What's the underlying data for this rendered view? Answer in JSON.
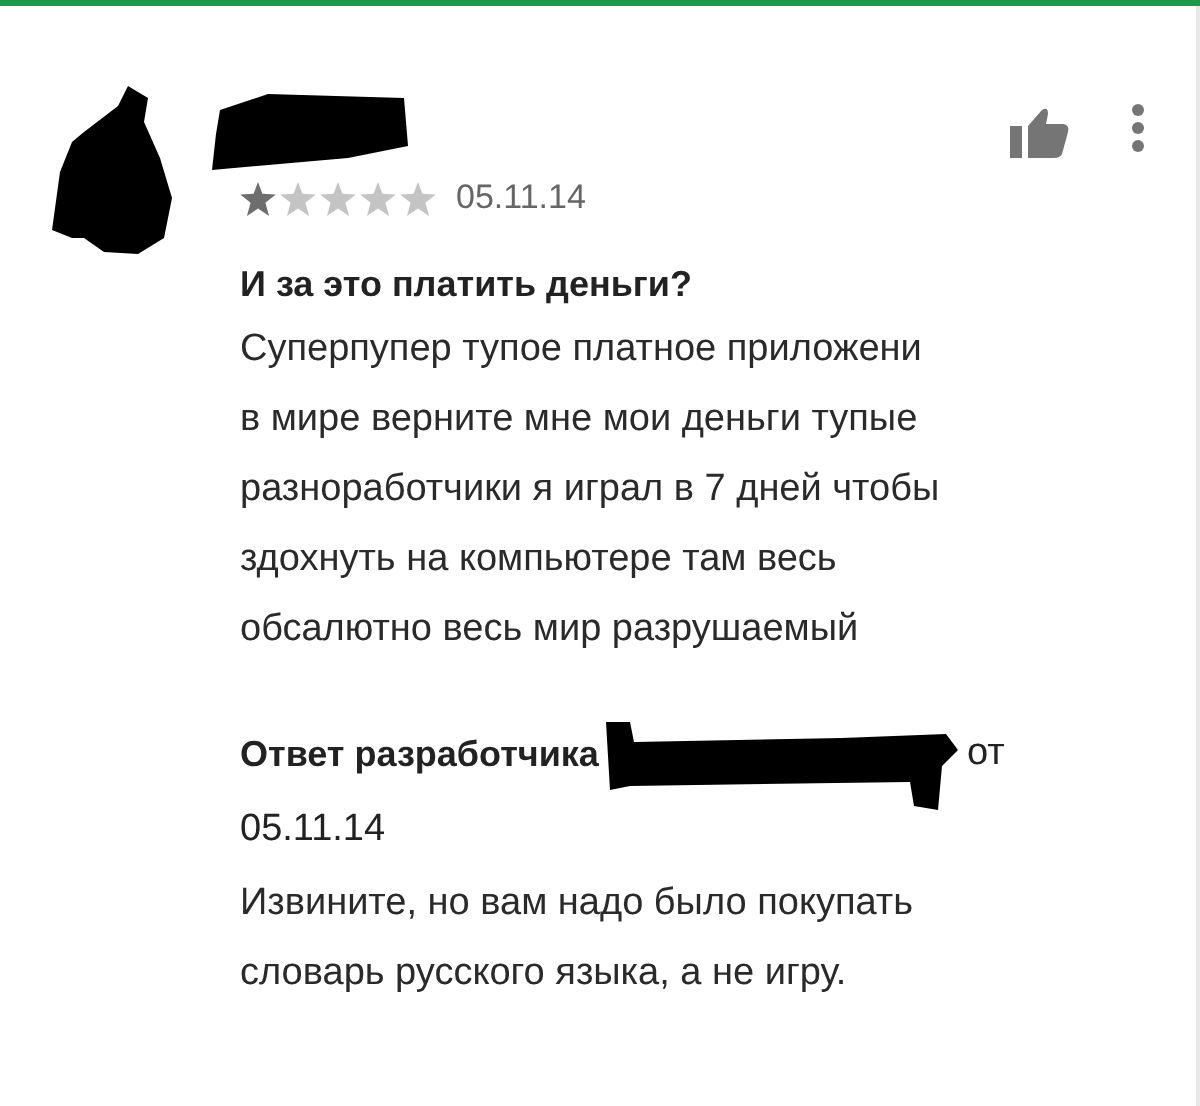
{
  "review": {
    "stars": 1,
    "date": "05.11.14",
    "title": "И за это платить деньги?",
    "text": "Суперпупер тупое платное приложени\nв мире верните мне мои деньги тупые\nразноработчики я играл в 7 дней чтобы\nздохнуть на компьютере там весь\nобсалютно весь мир разрушаемый"
  },
  "reply": {
    "label": "Ответ разработчика",
    "from": "от",
    "date": "05.11.14",
    "text": "Извините, но вам надо было покупать\nсловарь русского языка, а не игру."
  }
}
